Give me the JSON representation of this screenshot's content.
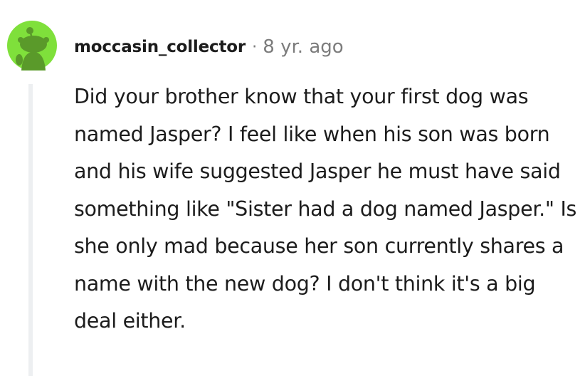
{
  "comment": {
    "username": "moccasin_collector",
    "separator": "·",
    "time": "8 yr. ago",
    "avatar_icon": "snoo-avatar-icon",
    "body": "Did your brother know that your first dog was named Jasper? I feel like when his son was born and his wife suggested Jasper he must have said something like \"Sister had a dog named Jasper.\" Is she only mad because her son currently shares a name with the new dog? I don't think it's a big deal either."
  },
  "colors": {
    "avatar_bg": "#7fe03b",
    "snoo_body": "#5a9a2a",
    "thread_line": "#edeff1",
    "text": "#1c1c1c",
    "meta": "#7c7c7c"
  }
}
